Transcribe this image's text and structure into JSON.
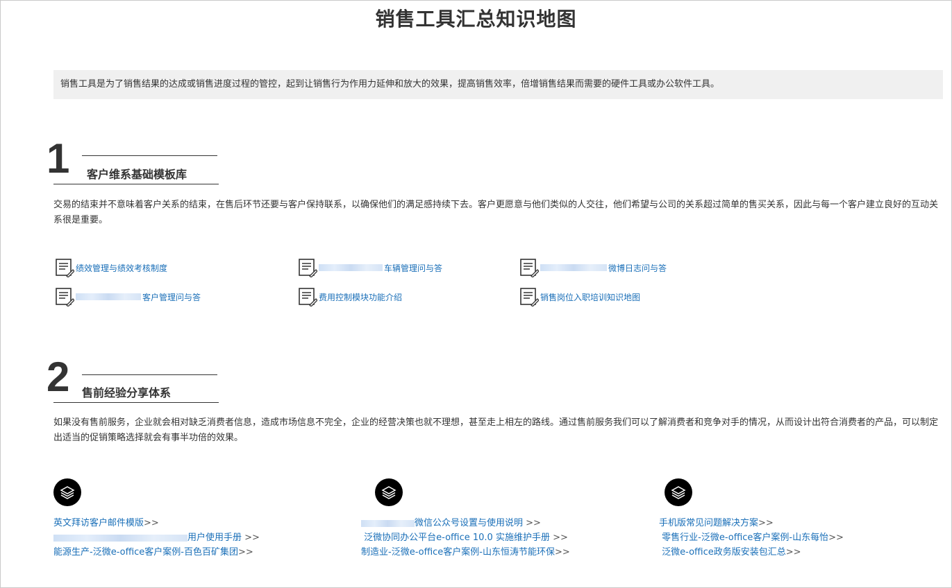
{
  "page": {
    "title": "销售工具汇总知识地图",
    "intro": "销售工具是为了销售结果的达成或销售进度过程的管控，起到让销售行为作用力延伸和放大的效果，提高销售效率，倍增销售结果而需要的硬件工具或办公软件工具。"
  },
  "section1": {
    "number": "1",
    "title": "客户维系基础模板库",
    "desc": "交易的结束并不意味着客户关系的结束，在售后环节还要与客户保持联系，以确保他们的满足感持续下去。客户更愿意与他们类似的人交往，他们希望与公司的关系超过简单的售买关系，因此与每一个客户建立良好的互动关系很是重要。",
    "docs": [
      {
        "label": "绩效管理与绩效考核制度",
        "icon": "document-icon"
      },
      {
        "label": "车辆管理问与答",
        "icon": "document-icon"
      },
      {
        "label": "微博日志问与答",
        "icon": "document-icon"
      },
      {
        "label": "客户管理问与答",
        "icon": "document-icon"
      },
      {
        "label": "费用控制模块功能介绍",
        "icon": "document-icon"
      },
      {
        "label": "销售岗位入职培训知识地图",
        "icon": "document-icon"
      }
    ]
  },
  "section2": {
    "number": "2",
    "title": "售前经验分享体系",
    "desc": "如果没有售前服务，企业就会相对缺乏消费者信息，造成市场信息不完全，企业的经营决策也就不理想，甚至走上相左的路线。通过售前服务我们可以了解消费者和竞争对手的情况，从而设计出符合消费者的产品，可以制定出适当的促销策略选择就会有事半功倍的效果。",
    "columns": [
      {
        "icon": "layers-icon",
        "links": [
          {
            "label": "英文拜访客户邮件模版",
            "arrow": ">>"
          },
          {
            "label": "用户使用手册",
            "arrow": ">>"
          },
          {
            "label": "能源生产-泛微e-office客户案例-百色百矿集团",
            "arrow": ">>"
          }
        ]
      },
      {
        "icon": "layers-icon",
        "links": [
          {
            "label": "微信公众号设置与使用说明",
            "arrow": ">>"
          },
          {
            "label": "泛微协同办公平台e-office 10.0 实施维护手册",
            "arrow": ">>"
          },
          {
            "label": "制造业-泛微e-office客户案例-山东恒涛节能环保",
            "arrow": ">>"
          }
        ]
      },
      {
        "icon": "layers-icon",
        "links": [
          {
            "label": "手机版常见问题解决方案",
            "arrow": ">>"
          },
          {
            "label": "零售行业-泛微e-office客户案例-山东每怡",
            "arrow": ">>"
          },
          {
            "label": "泛微e-office政务版安装包汇总",
            "arrow": ">>"
          }
        ]
      }
    ]
  },
  "colors": {
    "link": "#1a6fb8",
    "text": "#333333",
    "intro_bg": "#f0f0f0"
  }
}
